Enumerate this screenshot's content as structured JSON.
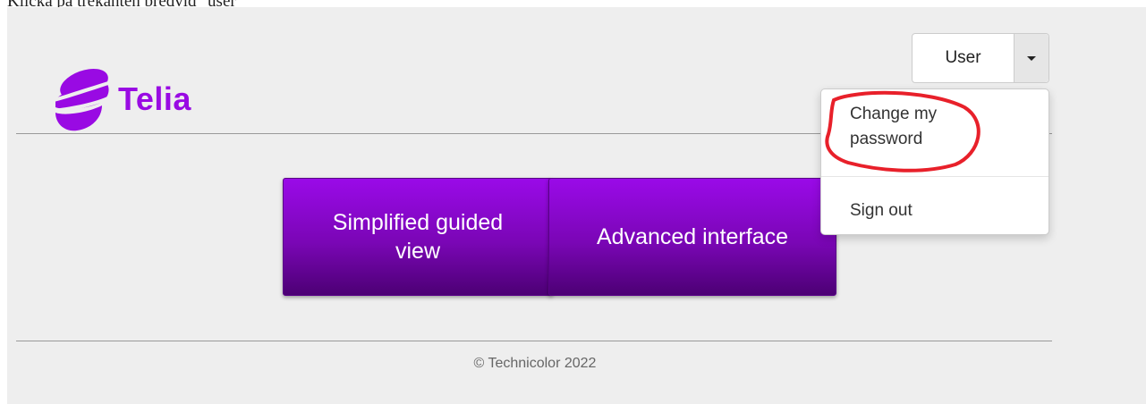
{
  "caption": "Klicka på trekanten bredvid \"user\"",
  "logo": {
    "brand": "Telia",
    "color": "#990ae3"
  },
  "user_dropdown": {
    "label": "User",
    "caret_icon": "caret-down-icon"
  },
  "menu": {
    "items": [
      "Change my password",
      "Sign out"
    ]
  },
  "buttons": {
    "simple": "Simplified guided view",
    "advanced": "Advanced interface"
  },
  "footer": "© Technicolor 2022",
  "colors": {
    "accent": "#990ae3",
    "annotation": "#e8202a"
  }
}
